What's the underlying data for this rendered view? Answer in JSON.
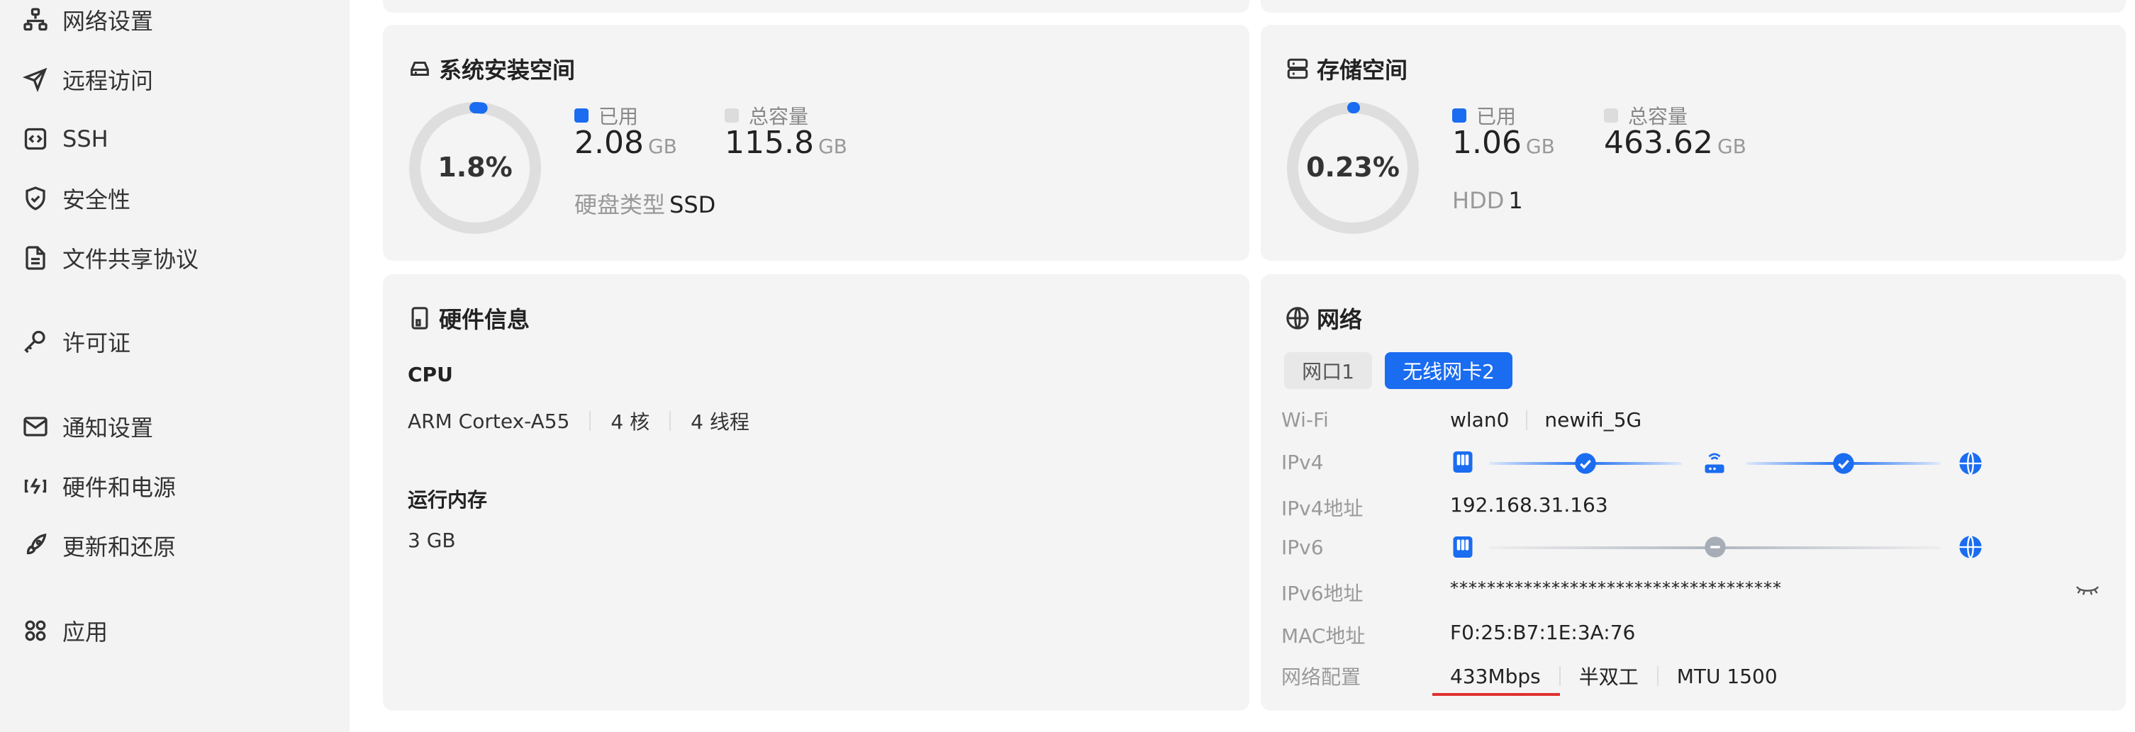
{
  "sidebar": {
    "items": [
      {
        "label": "网络设置",
        "icon": "network-icon"
      },
      {
        "label": "远程访问",
        "icon": "send-icon"
      },
      {
        "label": "SSH",
        "icon": "code-icon"
      },
      {
        "label": "安全性",
        "icon": "shield-icon"
      },
      {
        "label": "文件共享协议",
        "icon": "file-icon"
      },
      {
        "label": "许可证",
        "icon": "key-icon"
      },
      {
        "label": "通知设置",
        "icon": "mail-icon"
      },
      {
        "label": "硬件和电源",
        "icon": "power-icon"
      },
      {
        "label": "更新和还原",
        "icon": "rocket-icon"
      },
      {
        "label": "应用",
        "icon": "apps-icon"
      }
    ]
  },
  "system_space": {
    "title": "系统安装空间",
    "percent": "1.8%",
    "percent_value": 1.8,
    "used_label": "已用",
    "used_value": "2.08",
    "used_unit": "GB",
    "total_label": "总容量",
    "total_value": "115.8",
    "total_unit": "GB",
    "disk_type_label": "硬盘类型",
    "disk_type_value": "SSD"
  },
  "storage_space": {
    "title": "存储空间",
    "percent": "0.23%",
    "percent_value": 0.23,
    "used_label": "已用",
    "used_value": "1.06",
    "used_unit": "GB",
    "total_label": "总容量",
    "total_value": "463.62",
    "total_unit": "GB",
    "hdd_label": "HDD",
    "hdd_value": "1"
  },
  "hardware": {
    "title": "硬件信息",
    "cpu_label": "CPU",
    "cpu_model": "ARM Cortex-A55",
    "cpu_cores": "4 核",
    "cpu_threads": "4 线程",
    "memory_label": "运行内存",
    "memory_value": "3 GB"
  },
  "network": {
    "title": "网络",
    "tabs": [
      "网口1",
      "无线网卡2"
    ],
    "active_tab": 1,
    "wifi_label": "Wi-Fi",
    "wifi_iface": "wlan0",
    "wifi_ssid": "newifi_5G",
    "ipv4_label": "IPv4",
    "ipv4_addr_label": "IPv4地址",
    "ipv4_addr": "192.168.31.163",
    "ipv6_label": "IPv6",
    "ipv6_addr_label": "IPv6地址",
    "ipv6_addr": "************************************",
    "mac_label": "MAC地址",
    "mac_value": "F0:25:B7:1E:3A:76",
    "config_label": "网络配置",
    "speed": "433Mbps",
    "duplex": "半双工",
    "mtu": "MTU 1500"
  },
  "colors": {
    "accent": "#1a6cf0",
    "track": "#dedede",
    "underline": "#e03030"
  }
}
